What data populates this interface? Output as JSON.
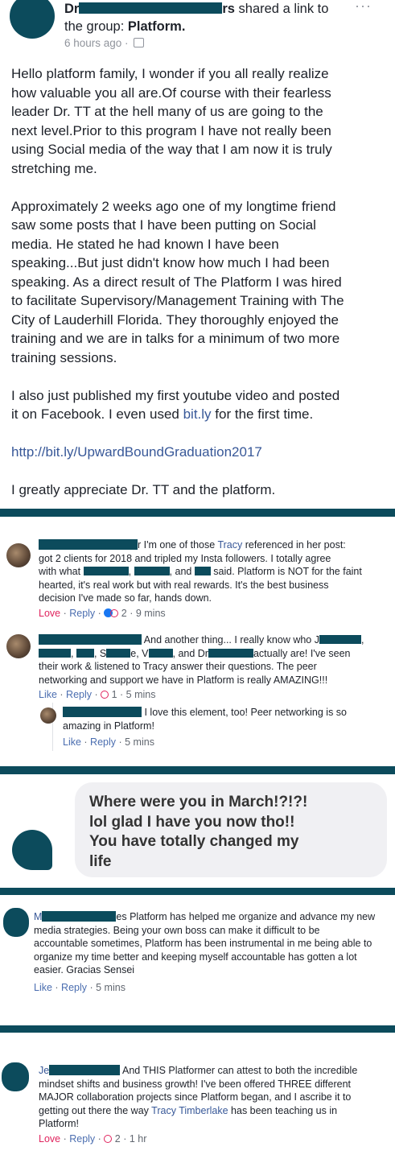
{
  "header": {
    "author_prefix": "Dr",
    "author_suffix": "rs",
    "shared_text": " shared a link to",
    "group_prefix": "the group: ",
    "group_name": "Platform.",
    "time": "6 hours ago ·",
    "more": "···"
  },
  "post": {
    "lines": [
      "Hello platform family, I wonder if you all really realize",
      "how valuable you all are.Of course with their fearless",
      "leader Dr. TT at the hell many of us are going to the",
      "next level.Prior to this program I have not really been",
      "using Social media of the way that I am now it is truly",
      "stretching me.",
      "Approximately 2 weeks ago one of my longtime friend",
      "saw some posts that I have been putting on Social",
      "media. He stated he had known I have been",
      "speaking...But just didn't know how much I had been",
      "speaking. As a direct result of The Platform I was hired",
      "to facilitate Supervisory/Management Training with The",
      "City of Lauderhill Florida. They thoroughly enjoyed the",
      "training and we are in talks for a minimum of two more",
      "training sessions.",
      "I also just published my first youtube video and posted",
      "it on Facebook. I even used ",
      "for the first time.",
      "I greatly appreciate Dr. TT and the platform."
    ],
    "bitly": "bit.ly",
    "url": "http://bit.ly/UpwardBoundGraduation2017"
  },
  "comment1": {
    "l1a": "r I'm one of those ",
    "tracy": "Tracy",
    "l1b": " referenced in her post:",
    "l2": "got 2 clients for 2018 and tripled my Insta followers. I totally agree",
    "l3a": "with what ",
    "l3b": ", ",
    "l3c": ", and ",
    "l3d": " said. Platform is NOT for the faint",
    "l4": "hearted, it's real work but with real rewards. It's the best business",
    "l5": "decision I've made so far, hands down.",
    "love": "Love",
    "reply": "Reply",
    "count": "2",
    "time": "9 mins"
  },
  "comment2": {
    "l1a": "And another thing... I really know who J",
    "l1b": ",",
    "l2a": ", ",
    "l2b": ", S",
    "l2c": "e, V",
    "l2d": ", and Dr",
    "l2e": "actually are! I've seen",
    "l3": "their work & listened to Tracy answer their questions. The peer",
    "l4": "networking and support we have in Platform is really AMAZING!!!",
    "like": "Like",
    "reply": "Reply",
    "count": "1",
    "time": "5 mins"
  },
  "reply1": {
    "l1": "I love this element, too! Peer networking is so",
    "l2": "amazing in Platform!",
    "like": "Like",
    "reply": "Reply",
    "time": "5 mins"
  },
  "message": {
    "l1": "Where were you in March!?!?!",
    "l2": "lol glad I have you now tho!!",
    "l3": "You have totally changed my",
    "l4": "life"
  },
  "comment3": {
    "l1a": "M",
    "l1b": "es Platform has helped me organize and advance my new",
    "l2": "media strategies. Being your own boss can make it difficult to be",
    "l3": "accountable sometimes, Platform has been instrumental in me being able to",
    "l4": "organize my time better and keeping myself accountable has gotten a lot",
    "l5": "easier. Gracias Sensei",
    "like": "Like",
    "reply": "Reply",
    "time": "5 mins"
  },
  "comment4": {
    "l1a": "Je",
    "l1b": " And THIS Platformer can attest to both the incredible",
    "l2": "mindset shifts and business growth! I've been offered THREE different",
    "l3": "MAJOR collaboration projects since Platform began, and I ascribe it to",
    "l4a": "getting out there the way ",
    "tracy": "Tracy Timberlake",
    "l4b": " has been teaching us in",
    "l5": "Platform!",
    "love": "Love",
    "reply": "Reply",
    "count": "2",
    "time": "1 hr"
  },
  "colors": {
    "accent": "#0c4b5c",
    "link": "#385898",
    "love": "#e0245e"
  }
}
